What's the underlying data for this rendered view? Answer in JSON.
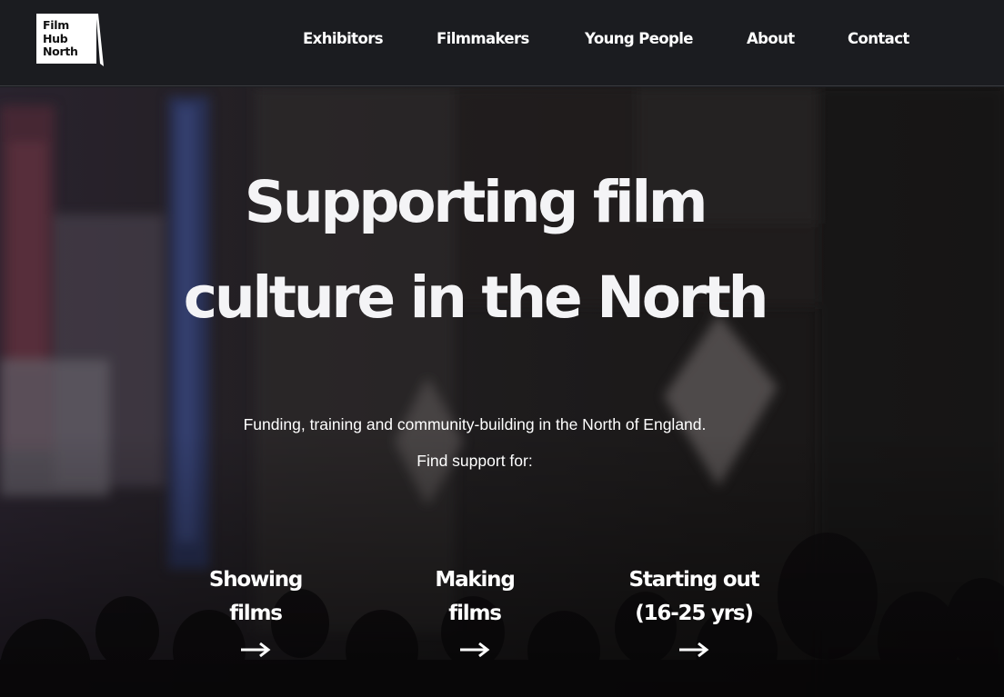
{
  "header": {
    "logo_text": "Film\nHub\nNorth",
    "nav": [
      {
        "label": "Exhibitors"
      },
      {
        "label": "Filmmakers"
      },
      {
        "label": "Young People"
      },
      {
        "label": "About"
      },
      {
        "label": "Contact"
      }
    ]
  },
  "hero": {
    "headline_line1": "Supporting film",
    "headline_line2": "culture in the North",
    "subtitle": "Funding, training and community-building in the North of England.",
    "find_support": "Find support for:",
    "cards": [
      {
        "label": "Showing\nfilms",
        "icon": "arrow-right-icon"
      },
      {
        "label": "Making\nfilms",
        "icon": "arrow-right-icon"
      },
      {
        "label": "Starting out\n(16-25 yrs)",
        "icon": "arrow-right-icon"
      }
    ]
  },
  "colors": {
    "header_bg": "#1b1c20",
    "text": "#ffffff",
    "logo_bg": "#ffffff"
  }
}
